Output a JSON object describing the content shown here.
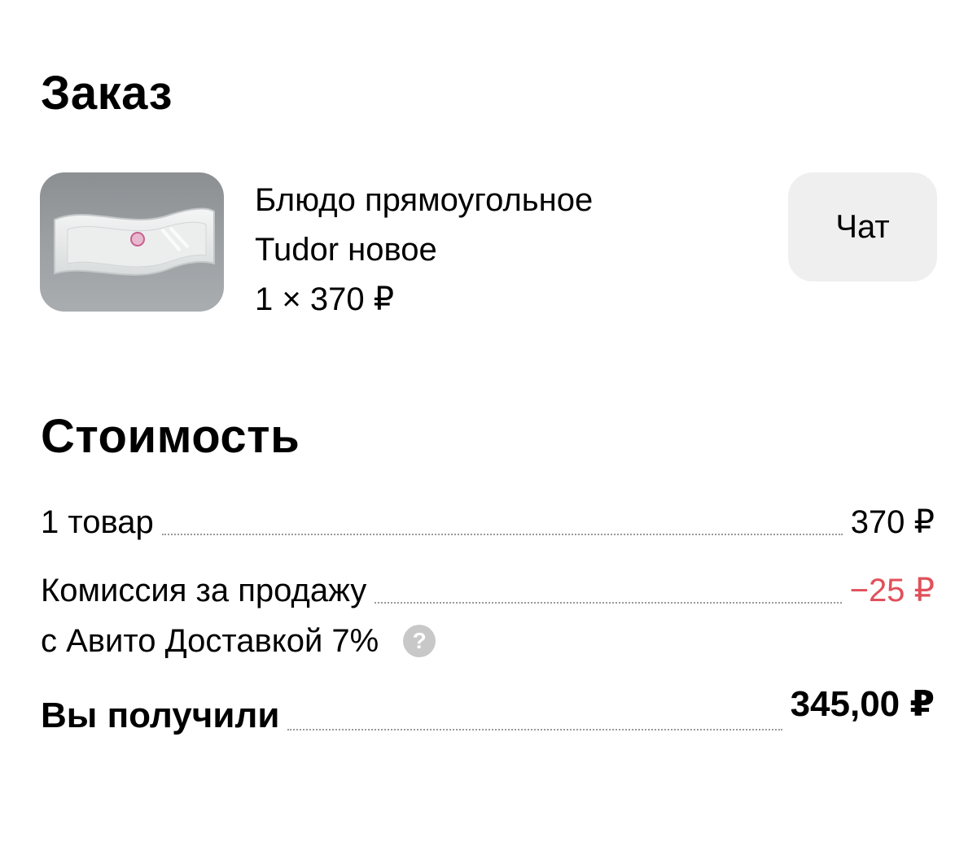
{
  "order": {
    "title": "Заказ",
    "item": {
      "name_line1": "Блюдо прямоугольное",
      "name_line2": "Tudor новое",
      "qty_price": "1 × 370 ₽",
      "image_icon": "rectangular-dish-photo"
    },
    "chat_button_label": "Чат"
  },
  "cost": {
    "title": "Стоимость",
    "goods": {
      "label": "1 товар",
      "value": "370 ₽"
    },
    "commission": {
      "label_line1": "Комиссия за продажу",
      "label_line2": "с Авито Доставкой 7%",
      "value": "−25 ₽",
      "help_icon": "question-mark-icon",
      "help_glyph": "?"
    },
    "total": {
      "label": "Вы получили",
      "value": "345,00 ₽"
    }
  },
  "colors": {
    "negative": "#e0505a",
    "button_bg": "#efefef",
    "help_icon_bg": "#c8c8c8"
  }
}
